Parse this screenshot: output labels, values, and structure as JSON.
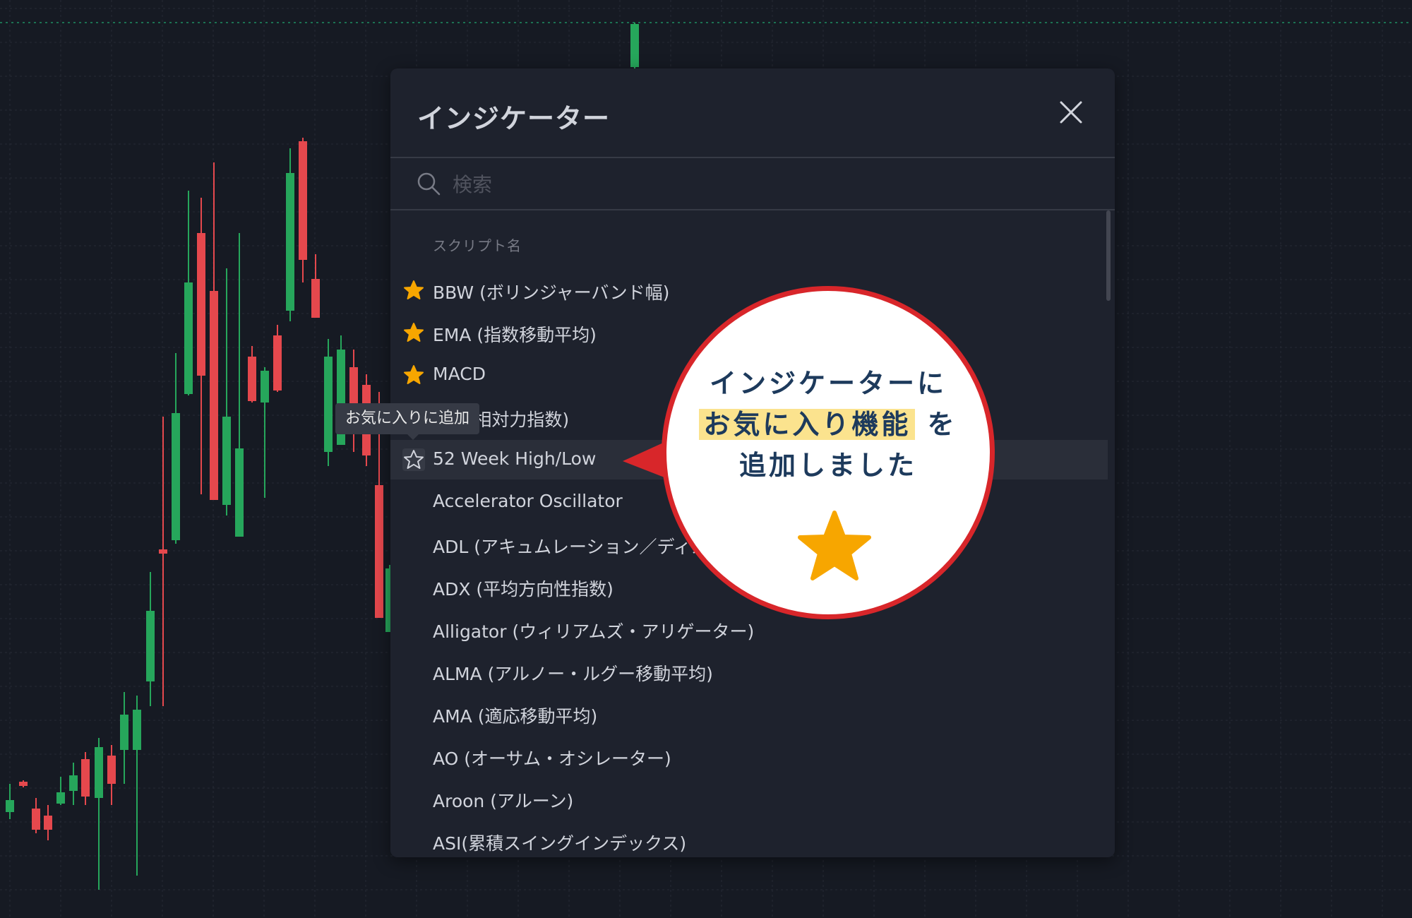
{
  "dialog": {
    "title": "インジケーター",
    "search": {
      "placeholder": "検索",
      "value": ""
    },
    "section_title": "スクリプト名",
    "items": [
      {
        "label": "BBW (ボリンジャーバンド幅)",
        "favorite": true
      },
      {
        "label": "EMA (指数移動平均)",
        "favorite": true
      },
      {
        "label": "MACD",
        "favorite": true
      },
      {
        "label": "RSI (相対力指数)",
        "favorite": false
      },
      {
        "label": "52 Week High/Low",
        "favorite": false,
        "hovered": true
      },
      {
        "label": "Accelerator Oscillator",
        "favorite": false
      },
      {
        "label": "ADL (アキュムレーション／ディストリビューション)",
        "favorite": false
      },
      {
        "label": "ADX (平均方向性指数)",
        "favorite": false
      },
      {
        "label": "Alligator (ウィリアムズ・アリゲーター)",
        "favorite": false
      },
      {
        "label": "ALMA (アルノー・ルグー移動平均)",
        "favorite": false
      },
      {
        "label": "AMA (適応移動平均)",
        "favorite": false
      },
      {
        "label": "AO (オーサム・オシレーター)",
        "favorite": false
      },
      {
        "label": "Aroon (アルーン)",
        "favorite": false
      },
      {
        "label": "ASI(累積スイングインデックス)",
        "favorite": false
      }
    ]
  },
  "tooltip": {
    "text": "お気に入りに追加"
  },
  "callout": {
    "line1": "インジケーターに",
    "line2_highlight": "お気に入り機能",
    "line2_rest": "を",
    "line3": "追加しました"
  },
  "icons": {
    "close": "close-icon",
    "search": "search-icon",
    "favorite": "star-filled-icon",
    "add_favorite": "star-outline-icon"
  },
  "colors": {
    "background": "#161a23",
    "panel": "#1e222d",
    "up_candle": "#26a65b",
    "down_candle": "#e5484d",
    "favorite_star": "#f7a600",
    "callout_border": "#d8262a",
    "callout_text": "#1d3a5c",
    "highlight": "#fbe38e"
  }
}
